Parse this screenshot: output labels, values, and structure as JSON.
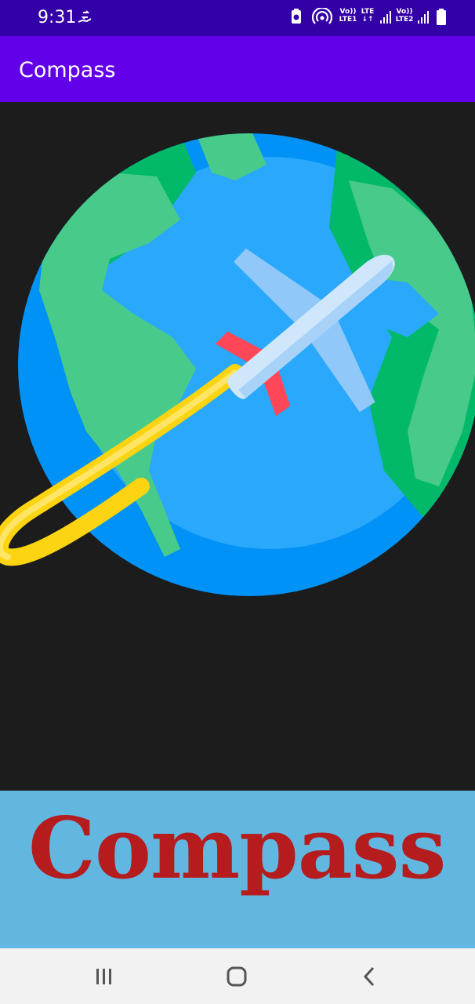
{
  "status_bar": {
    "time": "9:31",
    "sim1_label_top": "Vo))",
    "sim1_label_bottom": "LTE1",
    "lte_label": "LTE",
    "sim2_label_top": "Vo))",
    "sim2_label_bottom": "LTE2",
    "icons": [
      "hand-sync-icon",
      "battery-saver-icon",
      "hotspot-icon",
      "signal-icon",
      "battery-icon"
    ]
  },
  "app_bar": {
    "title": "Compass"
  },
  "hero": {
    "icon": "globe-airplane-icon"
  },
  "banner": {
    "text": "Compass"
  },
  "nav_bar": {
    "icons": [
      "recents-icon",
      "home-icon",
      "back-icon"
    ]
  },
  "colors": {
    "status_bar": "#3300a8",
    "app_bar": "#6200ea",
    "background": "#1c1c1c",
    "banner": "#62b7e1",
    "banner_text": "#b51c1d",
    "nav_bar": "#f2f2f2"
  }
}
